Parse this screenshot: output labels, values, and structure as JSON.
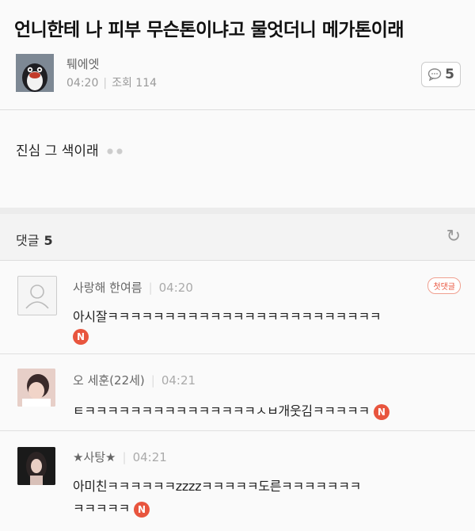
{
  "post": {
    "title": "언니한테 나 피부 무슨톤이냐고 물엇더니 메가톤이래",
    "author": "퉤에엣",
    "time": "04:20",
    "views": "조회 114",
    "comment_count": "5",
    "body": "진심 그 색이래"
  },
  "comments_section": {
    "label": "댓글",
    "count": "5"
  },
  "comments": [
    {
      "name": "사랑해 한여름",
      "time": "04:20",
      "badge": "첫댓글",
      "text": "아시잘ㅋㅋㅋㅋㅋㅋㅋㅋㅋㅋㅋㅋㅋㅋㅋㅋㅋㅋㅋㅋㅋㅋㅋㅋ",
      "new_label": "N"
    },
    {
      "name": "오 세훈(22세)",
      "time": "04:21",
      "text": "ㅌㅋㅋㅋㅋㅋㅋㅋㅋㅋㅋㅋㅋㅋㅋㅋㅅㅂ개웃김ㅋㅋㅋㅋㅋ",
      "new_label": "N"
    },
    {
      "name": "★사탕★",
      "time": "04:21",
      "text_line1": "아미친ㅋㅋㅋㅋㅋㅋzzzzㅋㅋㅋㅋㅋ도른ㅋㅋㅋㅋㅋㅋㅋ",
      "text_line2": "ㅋㅋㅋㅋㅋ",
      "new_label": "N"
    }
  ],
  "colors": {
    "accent": "#e8553e",
    "muted": "#999999"
  }
}
